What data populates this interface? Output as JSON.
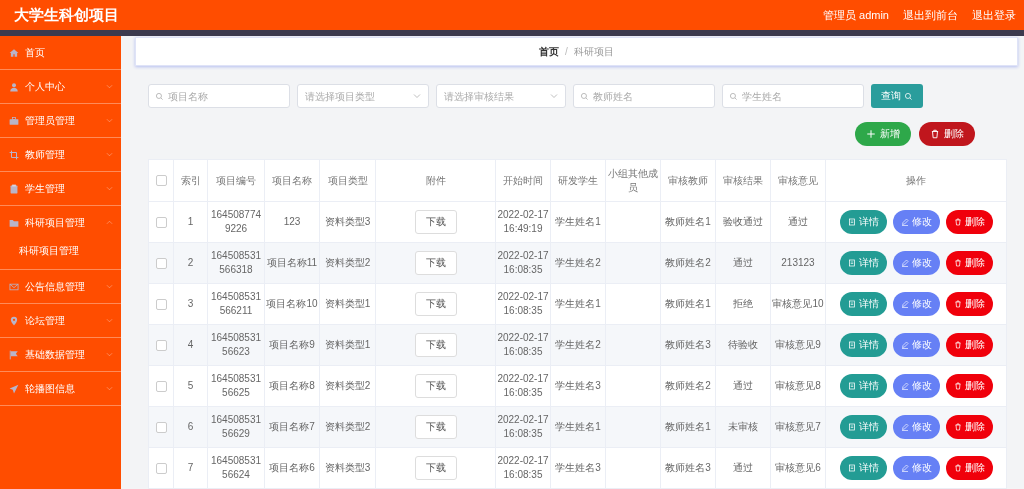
{
  "header": {
    "title": "大学生科创项目",
    "links": [
      "管理员 admin",
      "退出到前台",
      "退出登录"
    ]
  },
  "sidebar": {
    "items": [
      {
        "label": "首页"
      },
      {
        "label": "个人中心",
        "expanded": false
      },
      {
        "label": "管理员管理",
        "expanded": false
      },
      {
        "label": "教师管理",
        "expanded": false
      },
      {
        "label": "学生管理",
        "expanded": false
      },
      {
        "label": "科研项目管理",
        "expanded": true,
        "children": [
          {
            "label": "科研项目管理"
          }
        ]
      },
      {
        "label": "公告信息管理",
        "expanded": false
      },
      {
        "label": "论坛管理",
        "expanded": false
      },
      {
        "label": "基础数据管理",
        "expanded": false
      },
      {
        "label": "轮播图信息",
        "expanded": false
      }
    ]
  },
  "breadcrumb": {
    "items": [
      "首页",
      "科研项目"
    ],
    "separator": "/"
  },
  "filters": [
    {
      "kind": "text",
      "placeholder": "项目名称"
    },
    {
      "kind": "select",
      "placeholder": "请选择项目类型"
    },
    {
      "kind": "select",
      "placeholder": "请选择审核结果"
    },
    {
      "kind": "text",
      "placeholder": "教师姓名"
    },
    {
      "kind": "text",
      "placeholder": "学生姓名"
    }
  ],
  "search_button": "查询",
  "actions": [
    {
      "kind": "add",
      "label": "新增"
    },
    {
      "kind": "delete",
      "label": "删除"
    }
  ],
  "table": {
    "select_all": {
      "checked": false
    },
    "columns": [
      "索引",
      "项目编号",
      "项目名称",
      "项目类型",
      "附件",
      "开始时间",
      "研发学生",
      "小组其他成员",
      "审核教师",
      "审核结果",
      "审核意见",
      "操作"
    ],
    "rows": [
      {
        "checked": false,
        "index": "1",
        "code": "1645087749226",
        "name": "123",
        "type": "资料类型3",
        "attachment": "下载",
        "start": "2022-02-17 16:49:19",
        "student": "学生姓名1",
        "teacher": "教师姓名1",
        "result": "验收通过",
        "opinion": "通过",
        "actions": [
          "详情",
          "修改",
          "删除"
        ]
      },
      {
        "checked": false,
        "index": "2",
        "code": "164508531566318",
        "name": "项目名称11",
        "type": "资料类型2",
        "attachment": "下载",
        "start": "2022-02-17 16:08:35",
        "student": "学生姓名2",
        "teacher": "教师姓名2",
        "result": "通过",
        "opinion": "213123",
        "actions": [
          "详情",
          "修改",
          "删除"
        ]
      },
      {
        "checked": false,
        "index": "3",
        "code": "164508531566211",
        "name": "项目名称10",
        "type": "资料类型1",
        "attachment": "下载",
        "start": "2022-02-17 16:08:35",
        "student": "学生姓名1",
        "teacher": "教师姓名1",
        "result": "拒绝",
        "opinion": "审核意见10",
        "actions": [
          "详情",
          "修改",
          "删除"
        ]
      },
      {
        "checked": false,
        "index": "4",
        "code": "16450853156623",
        "name": "项目名称9",
        "type": "资料类型1",
        "attachment": "下载",
        "start": "2022-02-17 16:08:35",
        "student": "学生姓名2",
        "teacher": "教师姓名3",
        "result": "待验收",
        "opinion": "审核意见9",
        "actions": [
          "详情",
          "修改",
          "删除"
        ]
      },
      {
        "checked": false,
        "index": "5",
        "code": "16450853156625",
        "name": "项目名称8",
        "type": "资料类型2",
        "attachment": "下载",
        "start": "2022-02-17 16:08:35",
        "student": "学生姓名3",
        "teacher": "教师姓名2",
        "result": "通过",
        "opinion": "审核意见8",
        "actions": [
          "详情",
          "修改",
          "删除"
        ]
      },
      {
        "checked": false,
        "index": "6",
        "code": "16450853156629",
        "name": "项目名称7",
        "type": "资料类型2",
        "attachment": "下载",
        "start": "2022-02-17 16:08:35",
        "student": "学生姓名1",
        "teacher": "教师姓名1",
        "result": "未审核",
        "opinion": "审核意见7",
        "actions": [
          "详情",
          "修改",
          "删除"
        ]
      },
      {
        "checked": false,
        "index": "7",
        "code": "16450853156624",
        "name": "项目名称6",
        "type": "资料类型3",
        "attachment": "下载",
        "start": "2022-02-17 16:08:35",
        "student": "学生姓名3",
        "teacher": "教师姓名3",
        "result": "通过",
        "opinion": "审核意见6",
        "actions": [
          "详情",
          "修改",
          "删除"
        ]
      }
    ]
  }
}
